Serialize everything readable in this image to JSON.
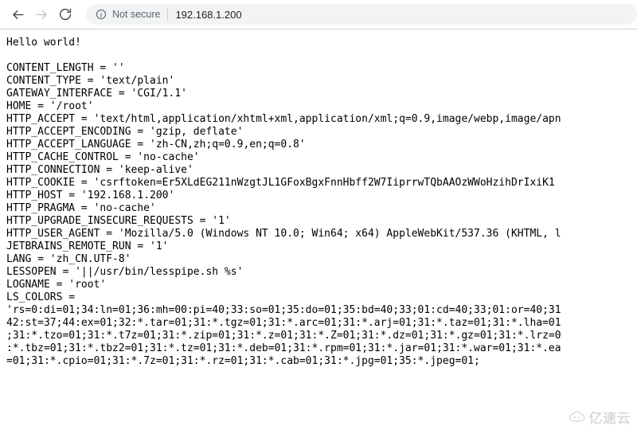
{
  "browser": {
    "back_label": "Back",
    "forward_label": "Forward",
    "reload_label": "Reload",
    "security_status": "Not secure",
    "url": "192.168.1.200",
    "icons": {
      "back": "back-arrow-icon",
      "forward": "forward-arrow-icon",
      "reload": "reload-icon",
      "info": "info-circle-icon"
    },
    "colors": {
      "omnibox_bg": "#f1f3f4",
      "security_text": "#5f6368",
      "url_text": "#202124",
      "icon_active": "#3c4043",
      "icon_disabled": "#bdc1c6"
    }
  },
  "content": {
    "greeting": "Hello world!",
    "body_text": "Hello world!\n\nCONTENT_LENGTH = ''\nCONTENT_TYPE = 'text/plain'\nGATEWAY_INTERFACE = 'CGI/1.1'\nHOME = '/root'\nHTTP_ACCEPT = 'text/html,application/xhtml+xml,application/xml;q=0.9,image/webp,image/apn\nHTTP_ACCEPT_ENCODING = 'gzip, deflate'\nHTTP_ACCEPT_LANGUAGE = 'zh-CN,zh;q=0.9,en;q=0.8'\nHTTP_CACHE_CONTROL = 'no-cache'\nHTTP_CONNECTION = 'keep-alive'\nHTTP_COOKIE = 'csrftoken=Er5XLdEG211nWzgtJL1GFoxBgxFnnHbff2W7IiprrwTQbAAOzWWoHzihDrIxiK1\nHTTP_HOST = '192.168.1.200'\nHTTP_PRAGMA = 'no-cache'\nHTTP_UPGRADE_INSECURE_REQUESTS = '1'\nHTTP_USER_AGENT = 'Mozilla/5.0 (Windows NT 10.0; Win64; x64) AppleWebKit/537.36 (KHTML, l\nJETBRAINS_REMOTE_RUN = '1'\nLANG = 'zh_CN.UTF-8'\nLESSOPEN = '||/usr/bin/lesspipe.sh %s'\nLOGNAME = 'root'\nLS_COLORS =\n'rs=0:di=01;34:ln=01;36:mh=00:pi=40;33:so=01;35:do=01;35:bd=40;33;01:cd=40;33;01:or=40;31\n42:st=37;44:ex=01;32:*.tar=01;31:*.tgz=01;31:*.arc=01;31:*.arj=01;31:*.taz=01;31:*.lha=01\n;31:*.tzo=01;31:*.t7z=01;31:*.zip=01;31:*.z=01;31:*.Z=01;31:*.dz=01;31:*.gz=01;31:*.lrz=0\n:*.tbz=01;31:*.tbz2=01;31:*.tz=01;31:*.deb=01;31:*.rpm=01;31:*.jar=01;31:*.war=01;31:*.ea\n=01;31:*.cpio=01;31:*.7z=01;31:*.rz=01;31:*.cab=01;31:*.jpg=01;35:*.jpeg=01;",
    "env_vars": [
      {
        "name": "CONTENT_LENGTH",
        "value": "''"
      },
      {
        "name": "CONTENT_TYPE",
        "value": "'text/plain'"
      },
      {
        "name": "GATEWAY_INTERFACE",
        "value": "'CGI/1.1'"
      },
      {
        "name": "HOME",
        "value": "'/root'"
      },
      {
        "name": "HTTP_ACCEPT",
        "value": "'text/html,application/xhtml+xml,application/xml;q=0.9,image/webp,image/apn"
      },
      {
        "name": "HTTP_ACCEPT_ENCODING",
        "value": "'gzip, deflate'"
      },
      {
        "name": "HTTP_ACCEPT_LANGUAGE",
        "value": "'zh-CN,zh;q=0.9,en;q=0.8'"
      },
      {
        "name": "HTTP_CACHE_CONTROL",
        "value": "'no-cache'"
      },
      {
        "name": "HTTP_CONNECTION",
        "value": "'keep-alive'"
      },
      {
        "name": "HTTP_COOKIE",
        "value": "'csrftoken=Er5XLdEG211nWzgtJL1GFoxBgxFnnHbff2W7IiprrwTQbAAOzWWoHzihDrIxiK1"
      },
      {
        "name": "HTTP_HOST",
        "value": "'192.168.1.200'"
      },
      {
        "name": "HTTP_PRAGMA",
        "value": "'no-cache'"
      },
      {
        "name": "HTTP_UPGRADE_INSECURE_REQUESTS",
        "value": "'1'"
      },
      {
        "name": "HTTP_USER_AGENT",
        "value": "'Mozilla/5.0 (Windows NT 10.0; Win64; x64) AppleWebKit/537.36 (KHTML, l"
      },
      {
        "name": "JETBRAINS_REMOTE_RUN",
        "value": "'1'"
      },
      {
        "name": "LANG",
        "value": "'zh_CN.UTF-8'"
      },
      {
        "name": "LESSOPEN",
        "value": "'||/usr/bin/lesspipe.sh %s'"
      },
      {
        "name": "LOGNAME",
        "value": "'root'"
      },
      {
        "name": "LS_COLORS",
        "value": ""
      }
    ]
  },
  "watermark": {
    "text": "亿速云",
    "icon": "cloud-icon",
    "color": "#b9bec4"
  }
}
